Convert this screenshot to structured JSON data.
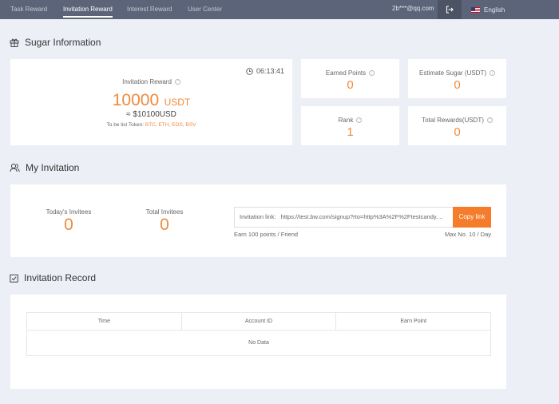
{
  "nav": {
    "tabs": [
      {
        "label": "Task Reward"
      },
      {
        "label": "Invitation Reward"
      },
      {
        "label": "Interest Reward"
      },
      {
        "label": "User Center"
      }
    ],
    "active_tab": "Invitation Reward",
    "email": "2b***@qq.com",
    "language": "English"
  },
  "sugar": {
    "title": "Sugar Information",
    "reward": {
      "label": "Invitation Reward",
      "timer": "06:13:41",
      "amount": "10000",
      "unit": "USDT",
      "approx": "≈ $10100USD",
      "token_prefix": "To be list Token:",
      "tokens": "BTC,  ETH,  EOS,  BSV"
    },
    "stats": [
      {
        "label": "Earned Points",
        "value": "0"
      },
      {
        "label": "Estimate Sugar (USDT)",
        "value": "0"
      },
      {
        "label": "Rank",
        "value": "1"
      },
      {
        "label": "Total Rewards(USDT)",
        "value": "0"
      }
    ]
  },
  "invitation": {
    "title": "My Invitation",
    "todays_label": "Today's Invitees",
    "todays_value": "0",
    "total_label": "Total Invitees",
    "total_value": "0",
    "link_label": "Invitation link:",
    "link_url": "https://test.bw.com/signup?rto=http%3A%2F%2Ftestcandy....",
    "copy_label": "Copy link",
    "earn_note": "Earn 100 points / Friend",
    "max_note": "Max No. 10 / Day"
  },
  "record": {
    "title": "Invitation Record",
    "columns": [
      "Time",
      "Account ID",
      "Earn Point"
    ],
    "empty_text": "No Data"
  },
  "colors": {
    "accent": "#f08a3c",
    "button": "#f57c2b",
    "topbar": "#5b6478",
    "background": "#eceff5"
  }
}
